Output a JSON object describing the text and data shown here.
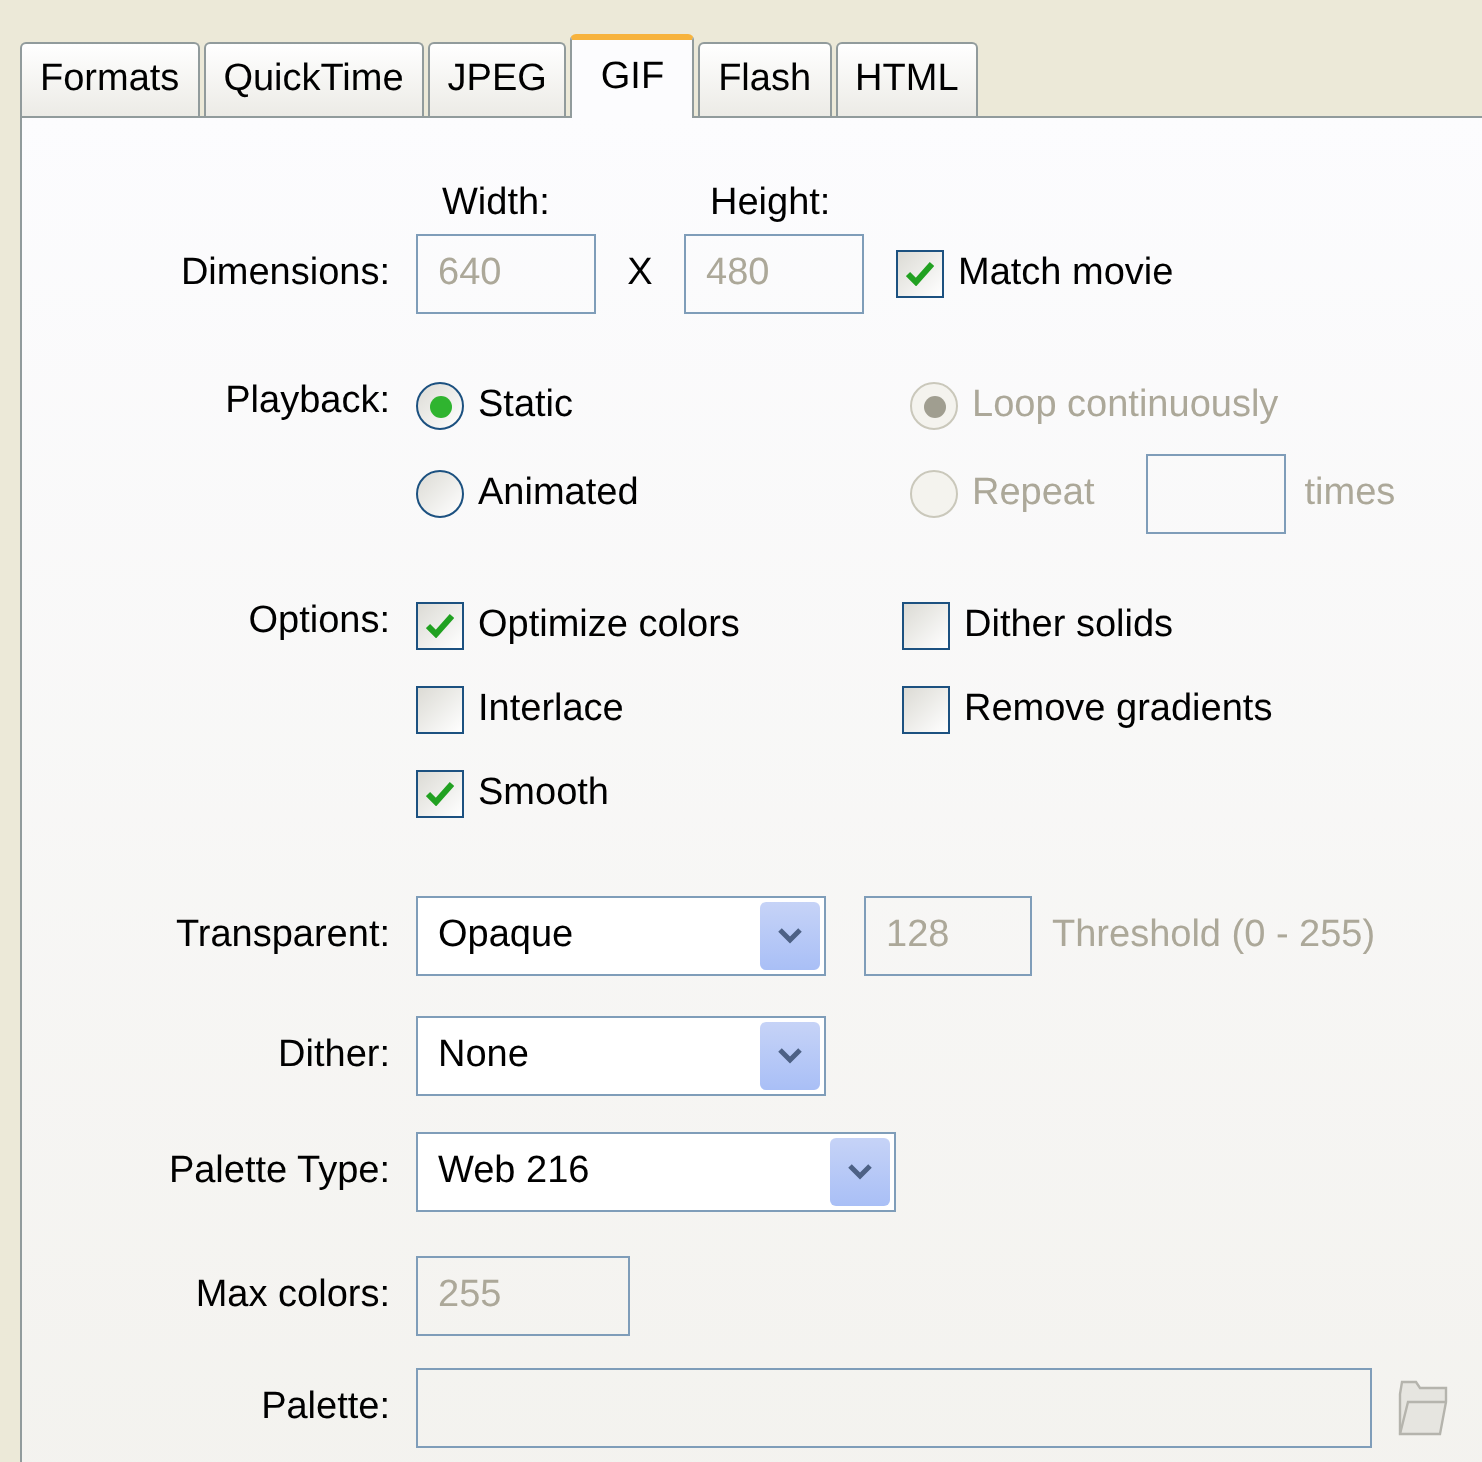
{
  "tabs": [
    {
      "label": "Formats",
      "selected": false
    },
    {
      "label": "QuickTime",
      "selected": false
    },
    {
      "label": "JPEG",
      "selected": false
    },
    {
      "label": "GIF",
      "selected": true
    },
    {
      "label": "Flash",
      "selected": false
    },
    {
      "label": "HTML",
      "selected": false
    }
  ],
  "dimensions": {
    "label": "Dimensions:",
    "width": {
      "label": "Width:",
      "value": "640",
      "disabled": true
    },
    "separator": "X",
    "height": {
      "label": "Height:",
      "value": "480",
      "disabled": true
    },
    "match_movie": {
      "label": "Match movie",
      "checked": true
    }
  },
  "playback": {
    "label": "Playback:",
    "modes": [
      {
        "label": "Static",
        "selected": true,
        "disabled": false
      },
      {
        "label": "Animated",
        "selected": false,
        "disabled": false
      }
    ],
    "loop_options": [
      {
        "label": "Loop continuously",
        "selected": true,
        "disabled": true
      },
      {
        "label": "Repeat",
        "selected": false,
        "disabled": true
      }
    ],
    "repeat_suffix": "times"
  },
  "options": {
    "label": "Options:",
    "left": [
      {
        "label": "Optimize colors",
        "checked": true
      },
      {
        "label": "Interlace",
        "checked": false
      },
      {
        "label": "Smooth",
        "checked": true
      }
    ],
    "right": [
      {
        "label": "Dither solids",
        "checked": false
      },
      {
        "label": "Remove gradients",
        "checked": false
      }
    ]
  },
  "transparent": {
    "label": "Transparent:",
    "value": "Opaque",
    "threshold": {
      "value": "128",
      "label": "Threshold (0 - 255)",
      "disabled": true
    }
  },
  "dither": {
    "label": "Dither:",
    "value": "None"
  },
  "palette_type": {
    "label": "Palette Type:",
    "value": "Web 216"
  },
  "max_colors": {
    "label": "Max colors:",
    "value": "255",
    "disabled": true
  },
  "palette": {
    "label": "Palette:",
    "disabled": true
  }
}
